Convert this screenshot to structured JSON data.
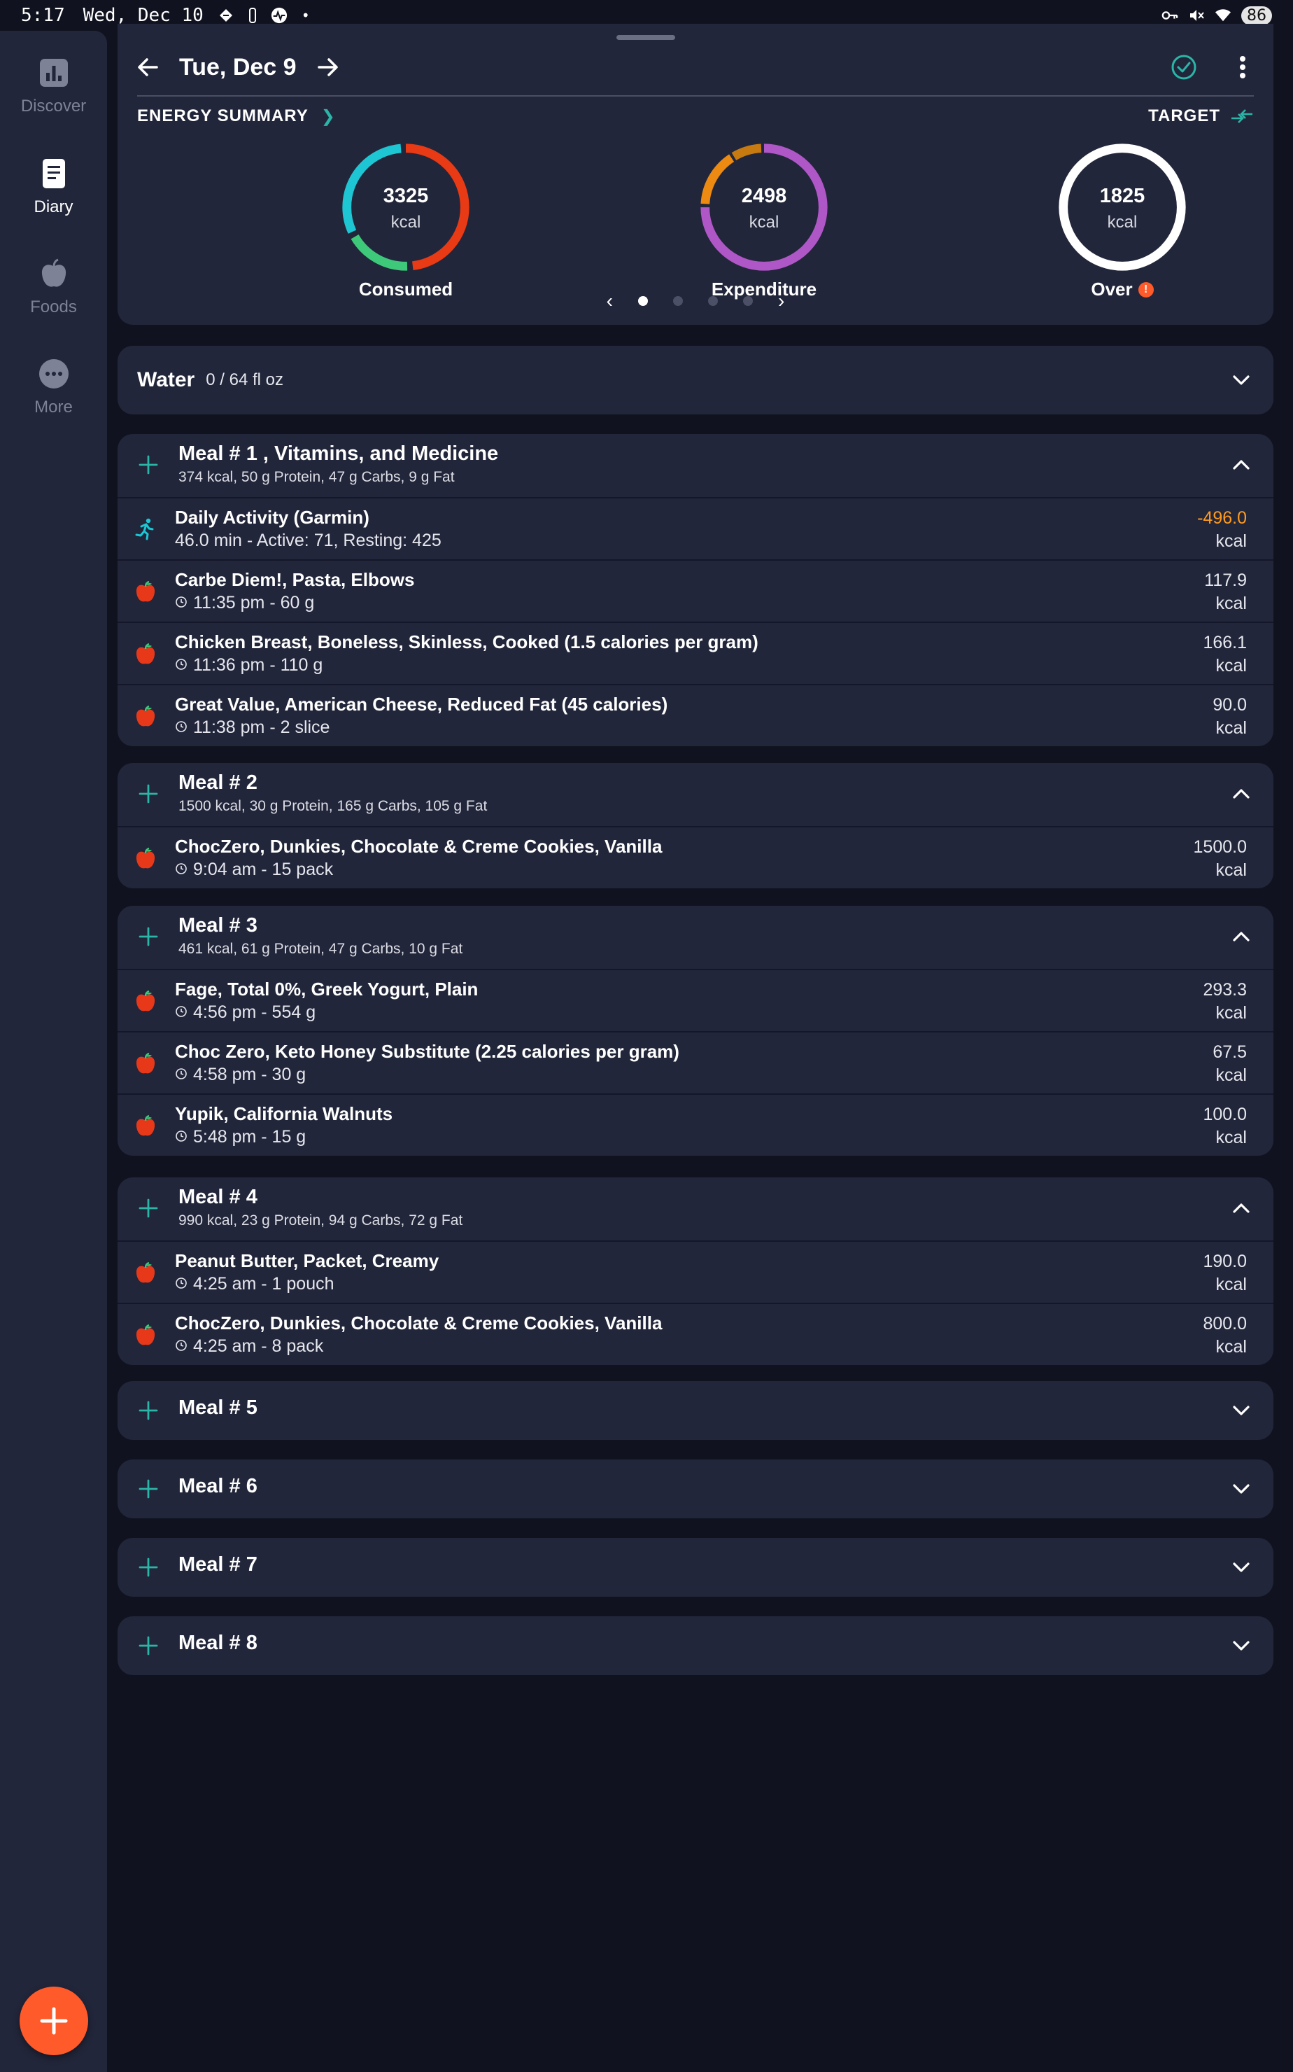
{
  "status_bar": {
    "time": "5:17",
    "date": "Wed, Dec 10",
    "battery": "86"
  },
  "sidebar": {
    "items": [
      {
        "label": "Discover",
        "icon": "bar-chart-icon",
        "active": false
      },
      {
        "label": "Diary",
        "icon": "notebook-icon",
        "active": true
      },
      {
        "label": "Foods",
        "icon": "apple-icon",
        "active": false
      },
      {
        "label": "More",
        "icon": "more-dots-icon",
        "active": false
      }
    ]
  },
  "header": {
    "date_title": "Tue, Dec 9"
  },
  "energy_summary": {
    "title": "ENERGY SUMMARY",
    "target_label": "TARGET",
    "rings": [
      {
        "value": "3325",
        "unit": "kcal",
        "label": "Consumed"
      },
      {
        "value": "2498",
        "unit": "kcal",
        "label": "Expenditure"
      },
      {
        "value": "1825",
        "unit": "kcal",
        "label": "Over"
      }
    ],
    "page_count": 4,
    "current_page": 1
  },
  "water": {
    "title": "Water",
    "value": "0 / 64 fl oz"
  },
  "meals": [
    {
      "title": "Meal # 1 , Vitamins, and Medicine",
      "macros": "374 kcal, 50 g Protein, 47 g Carbs, 9 g Fat",
      "expanded": true,
      "entries": [
        {
          "type": "activity",
          "name": "Daily Activity (Garmin)",
          "sub": "46.0 min - Active: 71, Resting: 425",
          "kcal": "-496.0",
          "unit": "kcal"
        },
        {
          "type": "food",
          "name": "Carbe Diem!, Pasta, Elbows",
          "sub": "11:35 pm - 60 g",
          "kcal": "117.9",
          "unit": "kcal"
        },
        {
          "type": "food",
          "name": "Chicken Breast, Boneless, Skinless, Cooked (1.5 calories per gram)",
          "sub": "11:36 pm - 110 g",
          "kcal": "166.1",
          "unit": "kcal"
        },
        {
          "type": "food",
          "name": "Great Value, American Cheese, Reduced Fat (45 calories)",
          "sub": "11:38 pm - 2 slice",
          "kcal": "90.0",
          "unit": "kcal"
        }
      ]
    },
    {
      "title": "Meal # 2",
      "macros": "1500 kcal, 30 g Protein, 165 g Carbs, 105 g Fat",
      "expanded": true,
      "entries": [
        {
          "type": "food",
          "name": "ChocZero, Dunkies, Chocolate & Creme Cookies, Vanilla",
          "sub": "9:04 am - 15 pack",
          "kcal": "1500.0",
          "unit": "kcal"
        }
      ]
    },
    {
      "title": "Meal # 3",
      "macros": "461 kcal, 61 g Protein, 47 g Carbs, 10 g Fat",
      "expanded": true,
      "entries": [
        {
          "type": "food",
          "name": "Fage, Total 0%, Greek Yogurt, Plain",
          "sub": "4:56 pm - 554 g",
          "kcal": "293.3",
          "unit": "kcal"
        },
        {
          "type": "food",
          "name": "Choc Zero, Keto Honey Substitute (2.25 calories per gram)",
          "sub": "4:58 pm - 30 g",
          "kcal": "67.5",
          "unit": "kcal"
        },
        {
          "type": "food",
          "name": "Yupik, California Walnuts",
          "sub": "5:48 pm - 15 g",
          "kcal": "100.0",
          "unit": "kcal"
        }
      ]
    },
    {
      "title": "Meal # 4",
      "macros": "990 kcal, 23 g Protein, 94 g Carbs, 72 g Fat",
      "expanded": true,
      "entries": [
        {
          "type": "food",
          "name": "Peanut Butter, Packet, Creamy",
          "sub": "4:25 am - 1 pouch",
          "kcal": "190.0",
          "unit": "kcal"
        },
        {
          "type": "food",
          "name": "ChocZero, Dunkies, Chocolate & Creme Cookies, Vanilla",
          "sub": "4:25 am - 8 pack",
          "kcal": "800.0",
          "unit": "kcal"
        }
      ]
    },
    {
      "title": "Meal # 5",
      "macros": "",
      "expanded": false,
      "entries": []
    },
    {
      "title": "Meal # 6",
      "macros": "",
      "expanded": false,
      "entries": []
    },
    {
      "title": "Meal # 7",
      "macros": "",
      "expanded": false,
      "entries": []
    },
    {
      "title": "Meal # 8",
      "macros": "",
      "expanded": false,
      "entries": []
    }
  ],
  "colors": {
    "accent": "#2bb5a7",
    "fab": "#ff5a2a",
    "negative_kcal": "#ff9a1f",
    "card_bg": "#22263a",
    "page_bg": "#10131f"
  }
}
